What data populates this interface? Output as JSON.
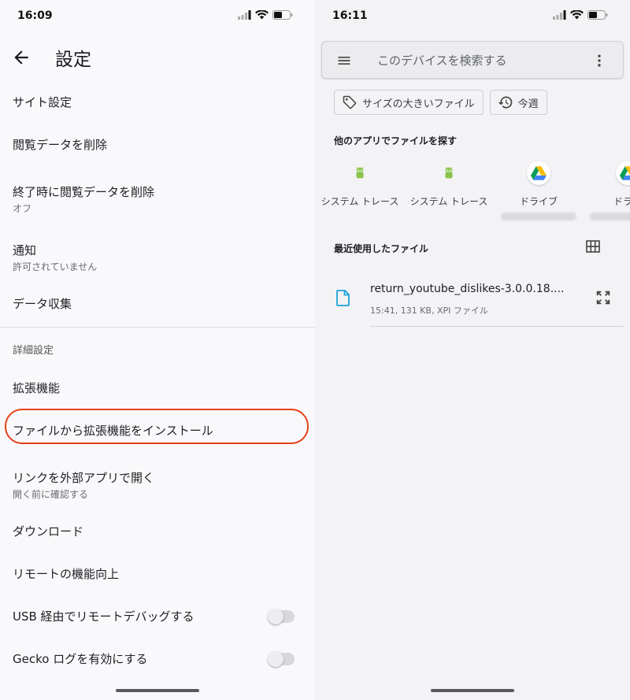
{
  "left": {
    "status": {
      "time": "16:09"
    },
    "appbar": {
      "title": "設定"
    },
    "rows": {
      "site_settings": "サイト設定",
      "clear_data": "閲覧データを削除",
      "clear_on_exit": {
        "label": "終了時に閲覧データを削除",
        "sub": "オフ"
      },
      "notifications": {
        "label": "通知",
        "sub": "許可されていません"
      },
      "data_collection": "データ収集",
      "advanced_header": "詳細設定",
      "extensions": "拡張機能",
      "install_from_file": "ファイルから拡張機能をインストール",
      "open_links": {
        "label": "リンクを外部アプリで開く",
        "sub": "開く前に確認する"
      },
      "downloads": "ダウンロード",
      "remote_improve": "リモートの機能向上",
      "usb_debug": "USB 経由でリモートデバッグする",
      "gecko_log": "Gecko ログを有効にする"
    },
    "toggles": {
      "usb_debug": false,
      "gecko_log": false
    },
    "highlight_color": "#e8401a"
  },
  "right": {
    "status": {
      "time": "16:11"
    },
    "search": {
      "placeholder": "このデバイスを検索する"
    },
    "chips": {
      "large_files": "サイズの大きいファイル",
      "this_week": "今週"
    },
    "find_in_apps": "他のアプリでファイルを探す",
    "apps": [
      {
        "name": "システム トレース",
        "icon": "android-bug-icon"
      },
      {
        "name": "システム トレース",
        "icon": "android-bug-icon"
      },
      {
        "name": "ドライブ",
        "icon": "google-drive-icon"
      },
      {
        "name": "ドライ",
        "icon": "google-drive-icon"
      }
    ],
    "recent_header": "最近使用したファイル",
    "recent_file": {
      "name": "return_youtube_dislikes-3.0.0.18....",
      "meta": "15:41, 131 KB, XPI ファイル"
    },
    "colors": {
      "accent": "#1aa3d9",
      "android_green": "#8bc34a"
    }
  }
}
